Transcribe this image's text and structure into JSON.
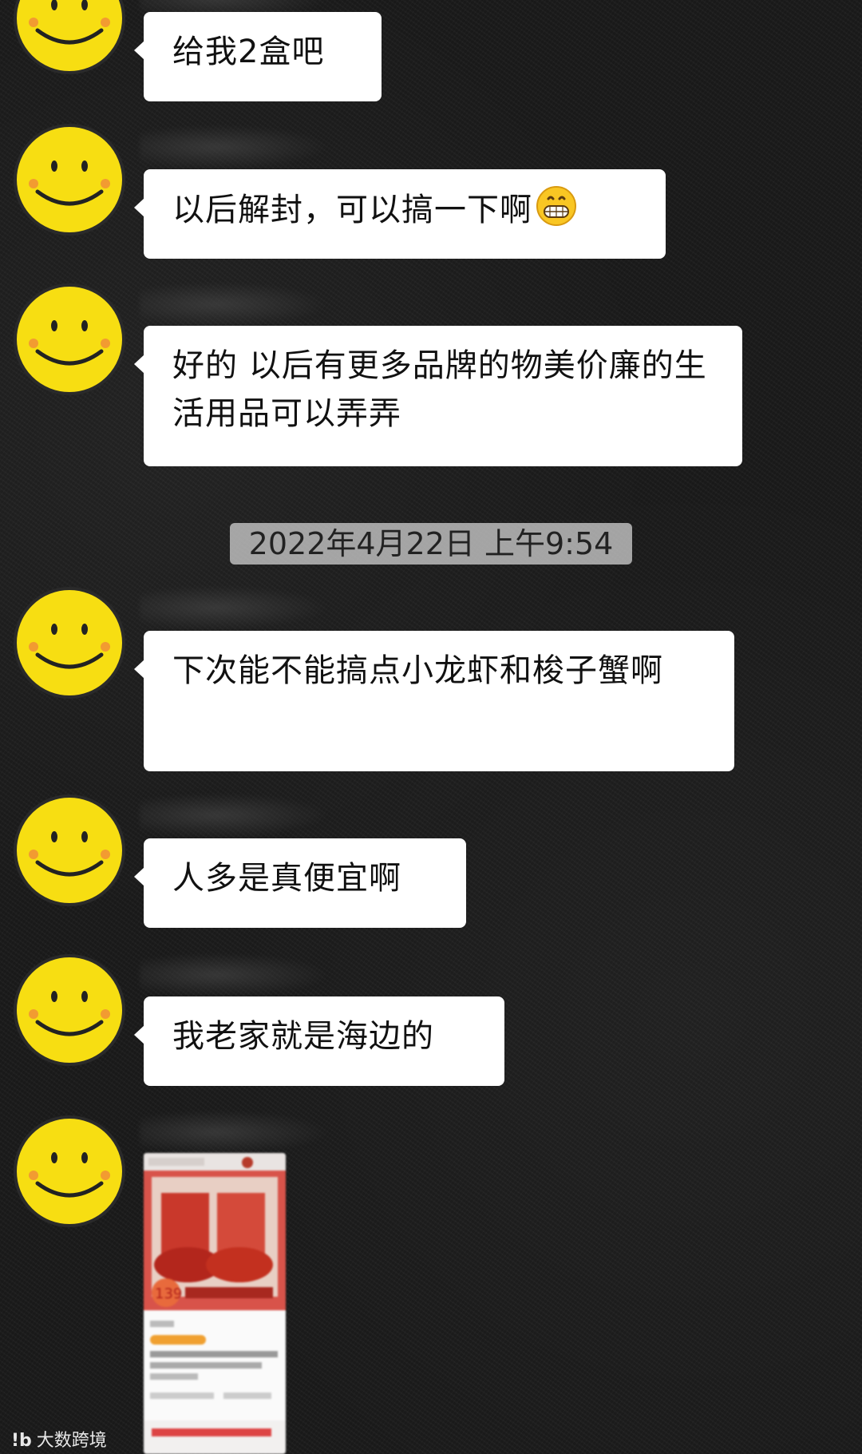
{
  "messages": [
    {
      "text": "给我2盒吧"
    },
    {
      "text": "以后解封，可以搞一下啊",
      "emoji": "grinning-face-emoji"
    },
    {
      "text": "好的 以后有更多品牌的物美价廉的生活用品可以弄弄"
    },
    {
      "text": "下次能不能搞点小龙虾和梭子蟹啊"
    },
    {
      "text": "人多是真便宜啊"
    },
    {
      "text": "我老家就是海边的"
    }
  ],
  "timestamp": "2022年4月22日 上午9:54",
  "image_message": {
    "price": "139"
  },
  "watermark": {
    "logo": "!b",
    "text": "大数跨境"
  },
  "colors": {
    "background": "#1a1a1a",
    "bubble": "#ffffff",
    "avatar_yellow": "#f5d90a",
    "timestamp_bg": "#d2d2d2",
    "product_red": "#d83a2a"
  }
}
